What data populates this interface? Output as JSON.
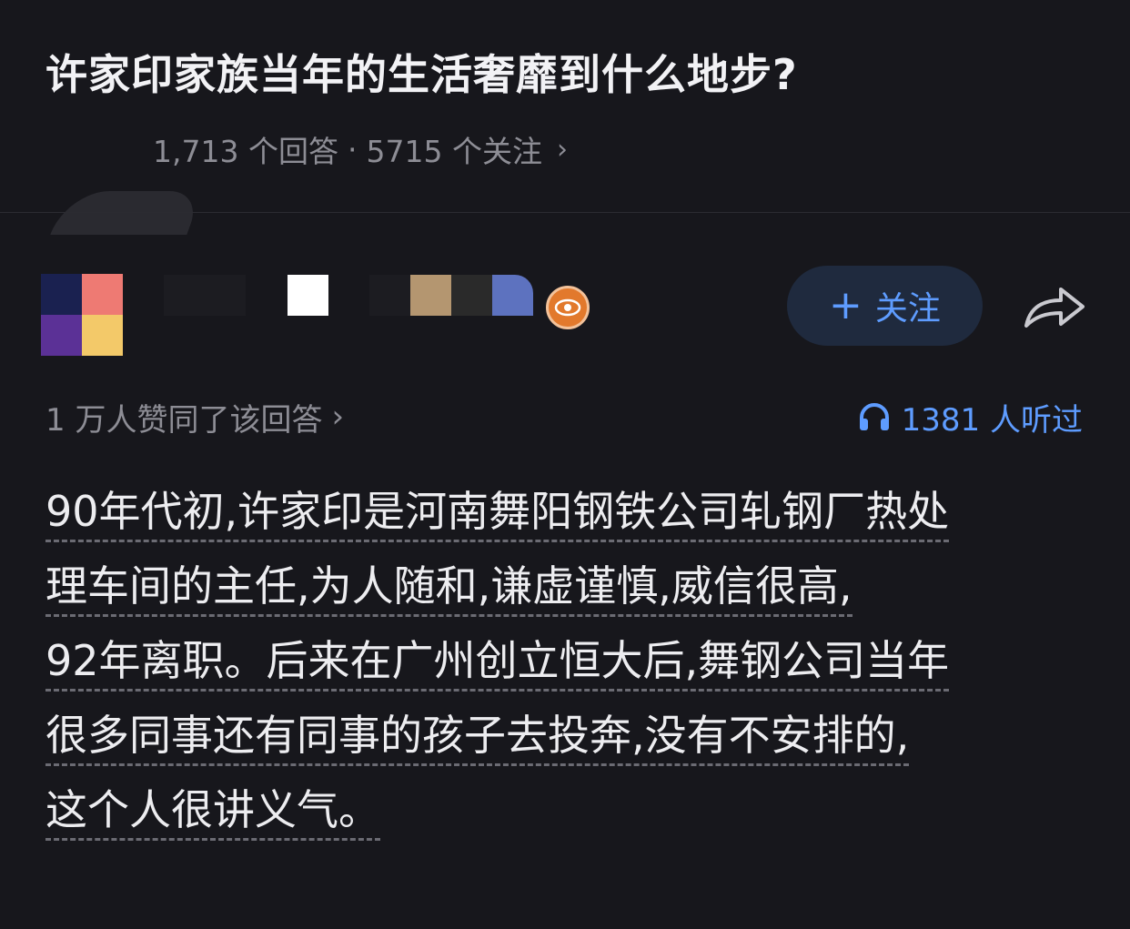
{
  "question": {
    "title": "许家印家族当年的生活奢靡到什么地步?",
    "answers_count": "1,713 个回答",
    "separator": "·",
    "followers_count": "5715 个关注",
    "chevron": "›"
  },
  "author": {
    "avatar_colors": [
      "#1a2150",
      "#ee7a73",
      "#5b3196",
      "#f3c969"
    ],
    "name_pixel_colors": [
      "#1c1c21",
      "#1c1c21",
      "#ffffff",
      "#1c1c21",
      "#b49670",
      "#2a2a2a",
      "#5d72bf"
    ],
    "badge_icon": "eye-badge-icon",
    "badge_color": "#e2792c"
  },
  "actions": {
    "follow_plus": "+",
    "follow_label": "关注",
    "share_icon": "share-arrow-icon"
  },
  "stats": {
    "likes_text": "1 万人赞同了该回答",
    "likes_chevron": "›",
    "listened_icon": "headphones-icon",
    "listened_text": "1381 人听过"
  },
  "answer": {
    "lines": [
      "90年代初,许家印是河南舞阳钢铁公司轧钢厂热处",
      "理车间的主任,为人随和,谦虚谨慎,威信很高,",
      "92年离职。后来在广州创立恒大后,舞钢公司当年",
      "很多同事还有同事的孩子去投奔,没有不安排的,",
      "这个人很讲义气。"
    ]
  },
  "colors": {
    "background": "#17171c",
    "accent": "#5e9cff",
    "muted": "#8d8d95"
  }
}
